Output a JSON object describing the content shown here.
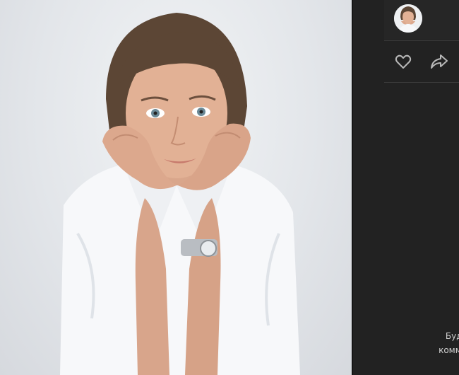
{
  "photo": {
    "alt_subject": "portrait-photo"
  },
  "author": {
    "name": "",
    "subtitle": ""
  },
  "actions": {
    "like_icon": "heart-icon",
    "share_icon": "share-arrow-icon"
  },
  "comments_hint": {
    "line1": "Будьте",
    "line2": "коммент"
  },
  "colors": {
    "sidebar_bg": "#222222",
    "panel_bg": "#262626",
    "icon": "#b8b8b8",
    "hint_text": "#d0d0d0"
  }
}
